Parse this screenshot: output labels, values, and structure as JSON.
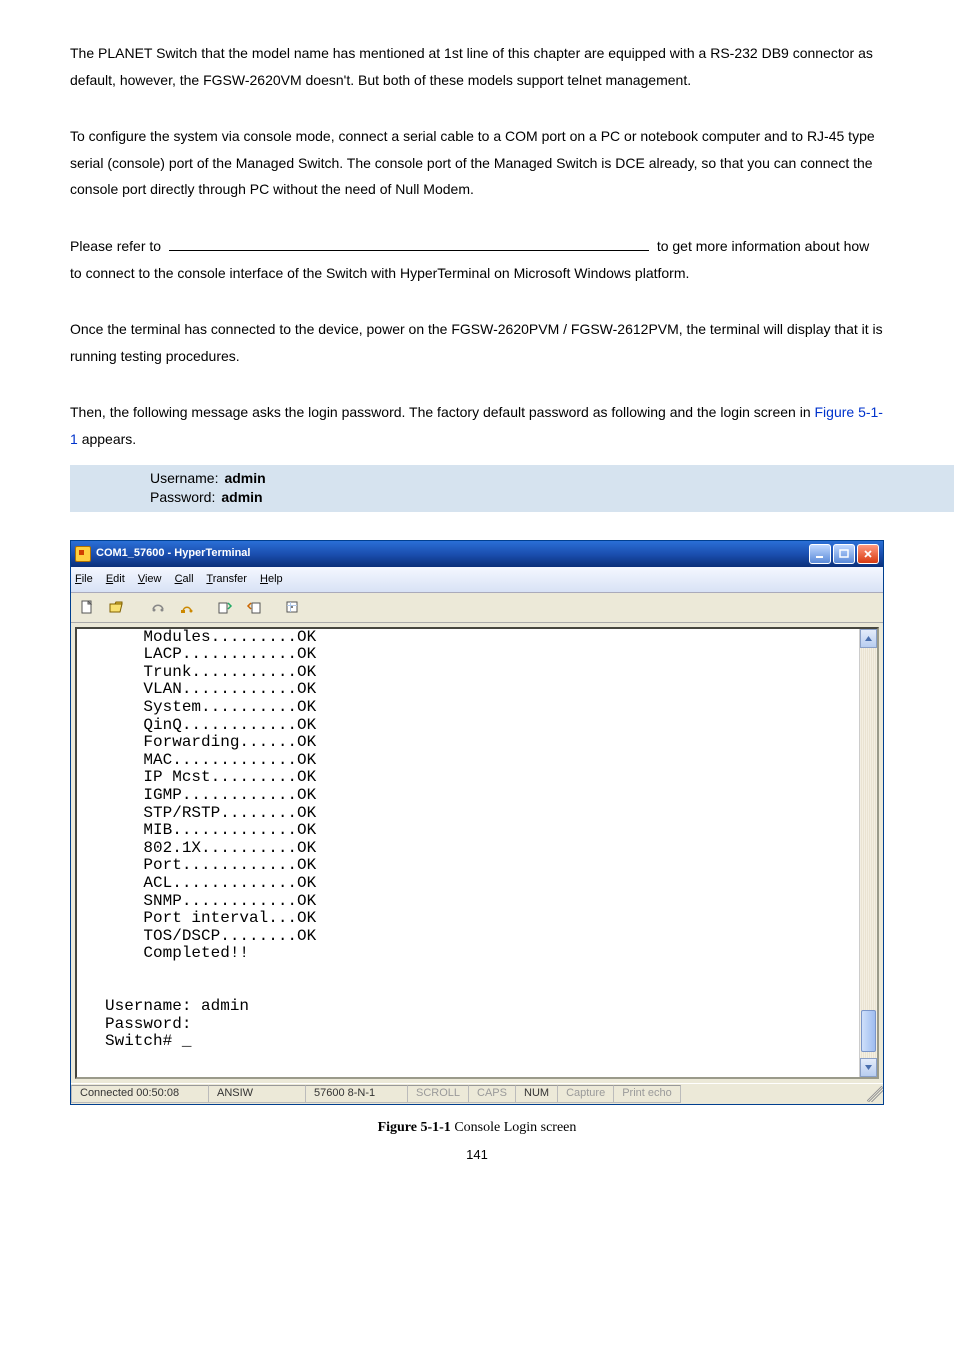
{
  "para1": "The PLANET Switch that the model name has mentioned at 1st line of this chapter are equipped with a RS-232 DB9 connector as default, however, the FGSW-2620VM doesn't. But both of these models support telnet management.",
  "para2": "To configure the system via console mode, connect a serial cable to a COM port on a PC or notebook computer and to RJ-45 type serial (console) port of the Managed Switch. The console port of the Managed Switch is DCE already, so that you can connect the console port directly through PC without the need of Null Modem.",
  "para3a": "Please refer to ",
  "para3b": " to get more information about how to connect to the console interface of the Switch with HyperTerminal on Microsoft Windows platform.",
  "para4": "Once the terminal has connected to the device, power on the FGSW-2620PVM / FGSW-2612PVM, the terminal will display that it is running testing procedures.",
  "para5a": "Then, the following message asks the login password. The factory default password as following and the login screen in ",
  "para5_ref": "Figure 5-1-1",
  "para5b": " appears.",
  "cred": {
    "userLabel": "Username:",
    "userVal": "admin",
    "passLabel": "Password:",
    "passVal": "admin"
  },
  "window": {
    "title": "COM1_57600 - HyperTerminal",
    "menu": {
      "file": "File",
      "edit": "Edit",
      "view": "View",
      "call": "Call",
      "transfer": "Transfer",
      "help": "Help"
    },
    "terminal_text": "    Modules.........OK\n    LACP............OK\n    Trunk...........OK\n    VLAN............OK\n    System..........OK\n    QinQ............OK\n    Forwarding......OK\n    MAC.............OK\n    IP Mcst.........OK\n    IGMP............OK\n    STP/RSTP........OK\n    MIB.............OK\n    802.1X..........OK\n    Port............OK\n    ACL.............OK\n    SNMP............OK\n    Port interval...OK\n    TOS/DSCP........OK\n    Completed!!\n\n\nUsername: admin\nPassword:\nSwitch# _",
    "status": {
      "conn": "Connected 00:50:08",
      "emu": "ANSIW",
      "port": "57600 8-N-1",
      "scroll": "SCROLL",
      "caps": "CAPS",
      "num": "NUM",
      "capture": "Capture",
      "echo": "Print echo"
    }
  },
  "caption_label": "Figure 5-1-1",
  "caption_text": " Console Login screen",
  "page": "141"
}
